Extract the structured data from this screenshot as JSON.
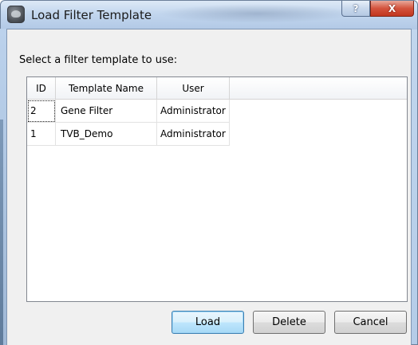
{
  "window": {
    "title": "Load Filter Template",
    "help_label": "?",
    "close_label": "X",
    "icon": "app-logo-icon"
  },
  "prompt": "Select a filter template to use:",
  "table": {
    "columns": [
      "ID",
      "Template Name",
      "User"
    ],
    "rows": [
      {
        "id": "2",
        "name": "Gene Filter",
        "user": "Administrator"
      },
      {
        "id": "1",
        "name": "TVB_Demo",
        "user": "Administrator"
      }
    ]
  },
  "buttons": {
    "load": "Load",
    "delete": "Delete",
    "cancel": "Cancel"
  },
  "colors": {
    "titlebar": "#c2d6ee",
    "close_button": "#c2361f",
    "default_button_border": "#3c7fb1",
    "dialog_background": "#f0f0f0"
  }
}
